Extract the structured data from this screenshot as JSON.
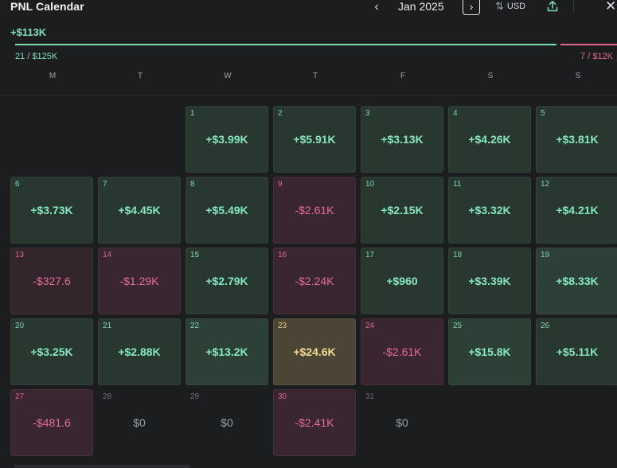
{
  "header": {
    "title": "PNL Calendar",
    "prev_glyph": "‹",
    "month": "Jan 2025",
    "next_glyph": "›",
    "currency": "USD",
    "close_glyph": "✕"
  },
  "summary": {
    "total": "+$113K",
    "wins": "21",
    "wins_amount": "$125K",
    "losses": "7",
    "losses_amount": "$12K",
    "slash": "/",
    "win_fraction": 0.9
  },
  "weekdays": [
    "M",
    "T",
    "W",
    "T",
    "F",
    "S",
    "S"
  ],
  "days": [
    {
      "day": "1",
      "value": "+$3.99K",
      "tone": "pos"
    },
    {
      "day": "2",
      "value": "+$5.91K",
      "tone": "pos"
    },
    {
      "day": "3",
      "value": "+$3.13K",
      "tone": "pos"
    },
    {
      "day": "4",
      "value": "+$4.26K",
      "tone": "pos"
    },
    {
      "day": "5",
      "value": "+$3.81K",
      "tone": "pos"
    },
    {
      "day": "6",
      "value": "+$3.73K",
      "tone": "pos"
    },
    {
      "day": "7",
      "value": "+$4.45K",
      "tone": "pos"
    },
    {
      "day": "8",
      "value": "+$5.49K",
      "tone": "pos"
    },
    {
      "day": "9",
      "value": "-$2.61K",
      "tone": "neg"
    },
    {
      "day": "10",
      "value": "+$2.15K",
      "tone": "pos"
    },
    {
      "day": "11",
      "value": "+$3.32K",
      "tone": "pos"
    },
    {
      "day": "12",
      "value": "+$4.21K",
      "tone": "pos"
    },
    {
      "day": "13",
      "value": "-$327.6",
      "tone": "neg2"
    },
    {
      "day": "14",
      "value": "-$1.29K",
      "tone": "neg"
    },
    {
      "day": "15",
      "value": "+$2.79K",
      "tone": "pos"
    },
    {
      "day": "16",
      "value": "-$2.24K",
      "tone": "neg"
    },
    {
      "day": "17",
      "value": "+$960",
      "tone": "pos"
    },
    {
      "day": "18",
      "value": "+$3.39K",
      "tone": "pos"
    },
    {
      "day": "19",
      "value": "+$8.33K",
      "tone": "pos2"
    },
    {
      "day": "20",
      "value": "+$3.25K",
      "tone": "pos"
    },
    {
      "day": "21",
      "value": "+$2.88K",
      "tone": "pos"
    },
    {
      "day": "22",
      "value": "+$13.2K",
      "tone": "pos2"
    },
    {
      "day": "23",
      "value": "+$24.6K",
      "tone": "gold"
    },
    {
      "day": "24",
      "value": "-$2.61K",
      "tone": "neg"
    },
    {
      "day": "25",
      "value": "+$15.8K",
      "tone": "pos2"
    },
    {
      "day": "26",
      "value": "+$5.11K",
      "tone": "pos"
    },
    {
      "day": "27",
      "value": "-$481.6",
      "tone": "neg"
    },
    {
      "day": "28",
      "value": "$0",
      "tone": "zero"
    },
    {
      "day": "29",
      "value": "$0",
      "tone": "zero"
    },
    {
      "day": "30",
      "value": "-$2.41K",
      "tone": "neg"
    },
    {
      "day": "31",
      "value": "$0",
      "tone": "zero"
    }
  ],
  "first_weekday_index": 2,
  "colors": {
    "positive": "#86e6bf",
    "negative": "#e86d95",
    "best_day": "#f2dc90",
    "background": "#1c1d1f"
  },
  "icons": {
    "prev": "chevron-left-icon",
    "next": "chevron-right-icon",
    "currency_toggle": "sort-arrows-icon",
    "export": "share-upload-icon",
    "close": "close-icon"
  }
}
